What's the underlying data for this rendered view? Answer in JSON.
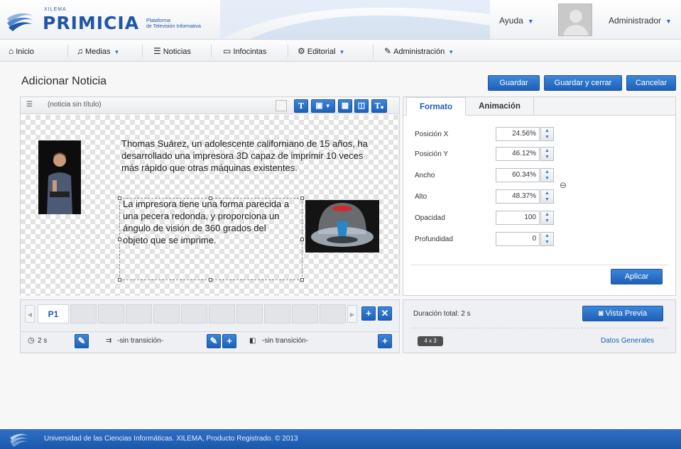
{
  "brand": {
    "top_label": "XILEMA",
    "name": "PRIMICIA",
    "subtitle_line1": "Plataforma",
    "subtitle_line2": "de Televisión Informativa"
  },
  "header": {
    "help_label": "Ayuda",
    "user_label": "Administrador"
  },
  "nav": {
    "items": [
      {
        "label": "Inicio",
        "icon": "home-icon"
      },
      {
        "label": "Medias",
        "icon": "music-note-icon"
      },
      {
        "label": "Noticias",
        "icon": "news-icon"
      },
      {
        "label": "Infocintas",
        "icon": "ticker-icon"
      },
      {
        "label": "Editorial",
        "icon": "editorial-icon"
      },
      {
        "label": "Administración",
        "icon": "wrench-icon"
      }
    ]
  },
  "page": {
    "title": "Adicionar Noticia",
    "save_label": "Guardar",
    "save_close_label": "Guardar y cerrar",
    "cancel_label": "Cancelar"
  },
  "editor": {
    "news_title": "(noticia sin título)",
    "toolbar_text_tool": "T",
    "toolbar_title_tool": "T",
    "paragraph1": "Thomas Suárez, un adolescente californiano de 15 años, ha desarrollado una impresora 3D capaz de imprimir 10 veces más rápido que otras máquinas existentes.",
    "paragraph2": "La impresora tiene una forma parecida a una pecera redonda, y proporciona un ángulo de visión de 360 grados del objeto que se imprime."
  },
  "properties": {
    "tab_format": "Formato",
    "tab_animation": "Animación",
    "fields": [
      {
        "label": "Posición X",
        "value": "24.56%"
      },
      {
        "label": "Posición Y",
        "value": "46.12%"
      },
      {
        "label": "Ancho",
        "value": "60.34%"
      },
      {
        "label": "Alto",
        "value": "48.37%"
      },
      {
        "label": "Opacidad",
        "value": "100"
      },
      {
        "label": "Profundidad",
        "value": "0"
      }
    ],
    "apply_label": "Aplicar"
  },
  "pages": {
    "current_page": "P1",
    "duration": "2 s",
    "transition_in": "-sin transición-",
    "transition_out": "-sin transición-"
  },
  "summary": {
    "total_duration": "Duración total: 2 s",
    "preview_label": "Vista Previa",
    "aspect_badge": "4 x 3",
    "general_data_link": "Datos Generales"
  },
  "footer": {
    "text": "Universidad de las Ciencias Informáticas. XILEMA, Producto Registrado. © 2013"
  },
  "colors": {
    "brand_blue": "#1f56a8",
    "button_blue": "#2e6fc2",
    "footer_blue": "#1b58aa"
  }
}
